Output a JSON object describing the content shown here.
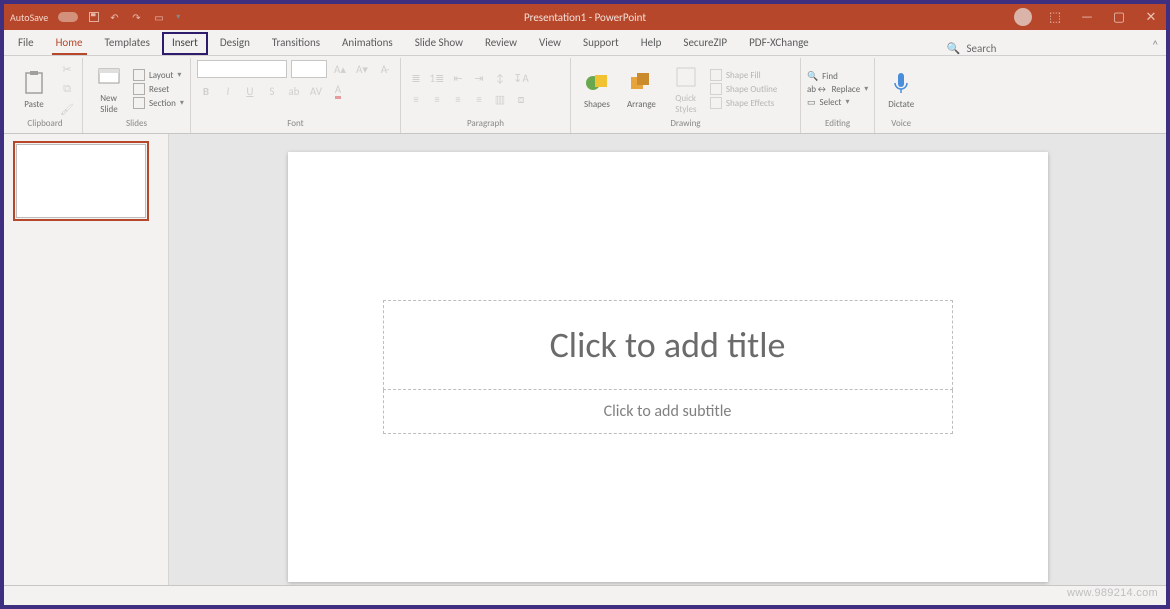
{
  "titlebar": {
    "autosave": "AutoSave",
    "title": "Presentation1 - PowerPoint"
  },
  "tabs": {
    "file": "File",
    "home": "Home",
    "templates": "Templates",
    "insert": "Insert",
    "design": "Design",
    "transitions": "Transitions",
    "animations": "Animations",
    "slideshow": "Slide Show",
    "review": "Review",
    "view": "View",
    "support": "Support",
    "help": "Help",
    "securezip": "SecureZIP",
    "pdfxchange": "PDF-XChange"
  },
  "search": {
    "label": "Search"
  },
  "ribbon": {
    "clipboard": {
      "paste": "Paste",
      "label": "Clipboard"
    },
    "slides": {
      "new_slide": "New\nSlide",
      "layout": "Layout",
      "reset": "Reset",
      "section": "Section",
      "label": "Slides"
    },
    "font": {
      "label": "Font"
    },
    "paragraph": {
      "label": "Paragraph"
    },
    "drawing": {
      "shapes": "Shapes",
      "arrange": "Arrange",
      "quick": "Quick\nStyles",
      "shape_fill": "Shape Fill",
      "shape_outline": "Shape Outline",
      "shape_effects": "Shape Effects",
      "label": "Drawing"
    },
    "editing": {
      "find": "Find",
      "replace": "Replace",
      "select": "Select",
      "label": "Editing"
    },
    "voice": {
      "dictate": "Dictate",
      "label": "Voice"
    }
  },
  "slide": {
    "title_placeholder": "Click to add title",
    "subtitle_placeholder": "Click to add subtitle"
  },
  "watermark": "www.989214.com"
}
